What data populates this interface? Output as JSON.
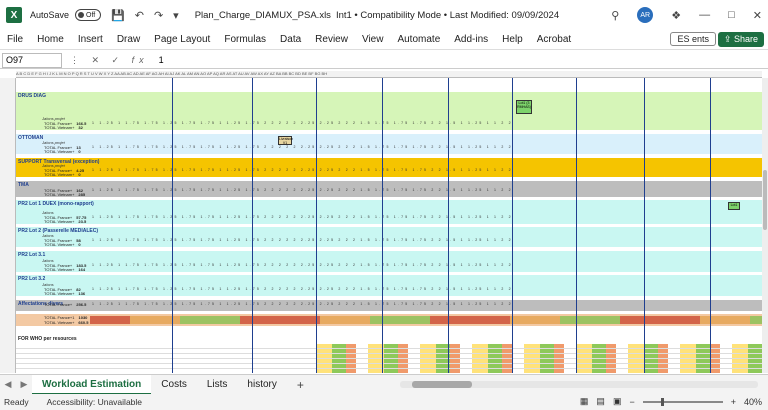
{
  "app": {
    "autosave_label": "AutoSave",
    "autosave_state": "Off",
    "file_name": "Plan_Charge_DIAMUX_PSA.xls",
    "doc_meta": "Int1 • Compatibility Mode • Last Modified: 09/09/2024",
    "user_initials": "AR"
  },
  "menu": {
    "items": [
      "File",
      "Home",
      "Insert",
      "Draw",
      "Page Layout",
      "Formulas",
      "Data",
      "Review",
      "View",
      "Automate",
      "Add-ins",
      "Help",
      "Acrobat"
    ],
    "lang_chip": "ES",
    "comments_label": "ents",
    "share_label": "Share"
  },
  "formula_bar": {
    "name_box": "O97",
    "formula": "1"
  },
  "sheet": {
    "bands": [
      {
        "label": "DRUS DIAG",
        "sub": "Jalons projet",
        "total1": "TOTAL France+",
        "total2": "TOTAL Vietnam+",
        "total1_value": "166.5",
        "total2_value": "32",
        "color": "#d6f5b8"
      },
      {
        "label": "OTTOMAN",
        "sub": "Jalons projet",
        "total1": "TOTAL France+",
        "total2": "TOTAL Vietnam+",
        "total1_value": "13",
        "total2_value": "0",
        "color": "#d9f0fb"
      },
      {
        "label": "SUPPORT Transversal (exception)",
        "sub": "Jalons projet",
        "total1": "TOTAL France+",
        "total2": "TOTAL Vietnam+",
        "total1_value": "4.25",
        "total2_value": "0",
        "color": "#f5c400"
      },
      {
        "label": "TMA",
        "sub": "",
        "total1": "TOTAL France+",
        "total2": "TOTAL Vietnam+",
        "total1_value": "162",
        "total2_value": "285",
        "color": "#bdbdbd"
      },
      {
        "label": "PR2 Lot 1 DUEX (mono-rapport)",
        "sub": "Jalons",
        "total1": "TOTAL France+",
        "total2": "TOTAL Vietnam+",
        "total1_value": "57.75",
        "total2_value": "23.5",
        "color": "#c9f7f2"
      },
      {
        "label": "PR2 Lot 2 (Passerelle MEDIALEC)",
        "sub": "Jalons",
        "total1": "TOTAL France+",
        "total2": "TOTAL Vietnam+",
        "total1_value": "58",
        "total2_value": "0",
        "color": "#c9f7f2"
      },
      {
        "label": "PR2 Lot 3.1",
        "sub": "Jalons",
        "total1": "TOTAL France+",
        "total2": "TOTAL Vietnam+",
        "total1_value": "183.5",
        "total2_value": "164",
        "color": "#c9f7f2"
      },
      {
        "label": "PR2 Lot 3.2",
        "sub": "Jalons",
        "total1": "TOTAL France+",
        "total2": "TOTAL Vietnam+",
        "total1_value": "82",
        "total2_value": "136",
        "color": "#c9f7f2"
      },
      {
        "label": "Affectations divers",
        "sub": "",
        "total1": "TOTAL France+",
        "total2": "",
        "total1_value": "256.5",
        "total2_value": "",
        "color": "#bdbdbd"
      }
    ],
    "grand_total_france": "TOTAL France+1",
    "grand_total_vietnam": "TOTAL Vietnam+",
    "grand_total_france_value": "1030",
    "grand_total_vietnam_value": "660.5",
    "bottom_label": "FOR WHO per resources",
    "cell_pattern": "1 1.25 1 1.75 1.75 1.25 1.75 1.75 1 1.25 1.75 2 2 2 2 2 2.25 2.25 2 2 2 1.5 1.75 1.75 1.75 2 2 1.5 1 1.25 1 1 2 2",
    "notes": [
      "Lot1 (3 RMHAS)",
      "Livraison V1",
      "Lot1"
    ]
  },
  "tabs": [
    "Workload Estimation",
    "Costs",
    "Lists",
    "history"
  ],
  "status": {
    "ready": "Ready",
    "accessibility": "Accessibility: Unavailable",
    "zoom": "40%"
  }
}
